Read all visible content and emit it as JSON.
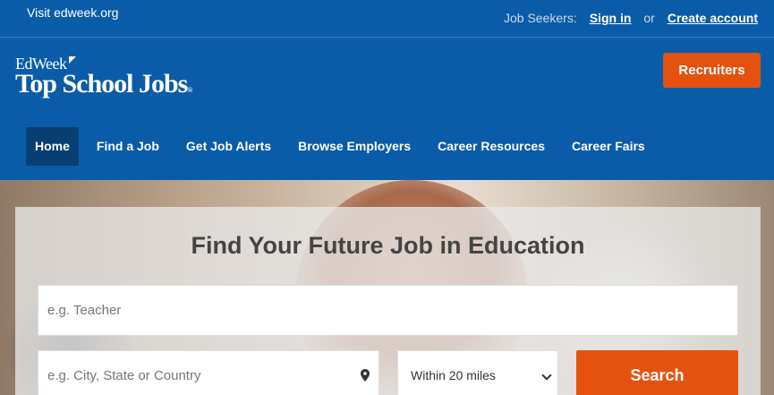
{
  "topbar": {
    "visit_link": "Visit edweek.org",
    "job_seekers_label": "Job Seekers:",
    "sign_in": "Sign in",
    "or_text": "or",
    "create_account": "Create account"
  },
  "logo": {
    "line1": "EdWeek",
    "line2": "Top School Jobs",
    "reg_mark": "®"
  },
  "header": {
    "recruiters_button": "Recruiters"
  },
  "nav": {
    "items": [
      {
        "label": "Home",
        "active": true
      },
      {
        "label": "Find a Job"
      },
      {
        "label": "Get Job Alerts"
      },
      {
        "label": "Browse Employers"
      },
      {
        "label": "Career Resources"
      },
      {
        "label": "Career Fairs"
      }
    ]
  },
  "hero": {
    "title": "Find Your Future Job in Education",
    "keyword_placeholder": "e.g. Teacher",
    "location_placeholder": "e.g. City, State or Country",
    "radius_selected": "Within 20 miles",
    "search_button": "Search"
  },
  "colors": {
    "brand_blue": "#0b5ca8",
    "nav_active": "#083f73",
    "accent_orange": "#e3530f"
  }
}
